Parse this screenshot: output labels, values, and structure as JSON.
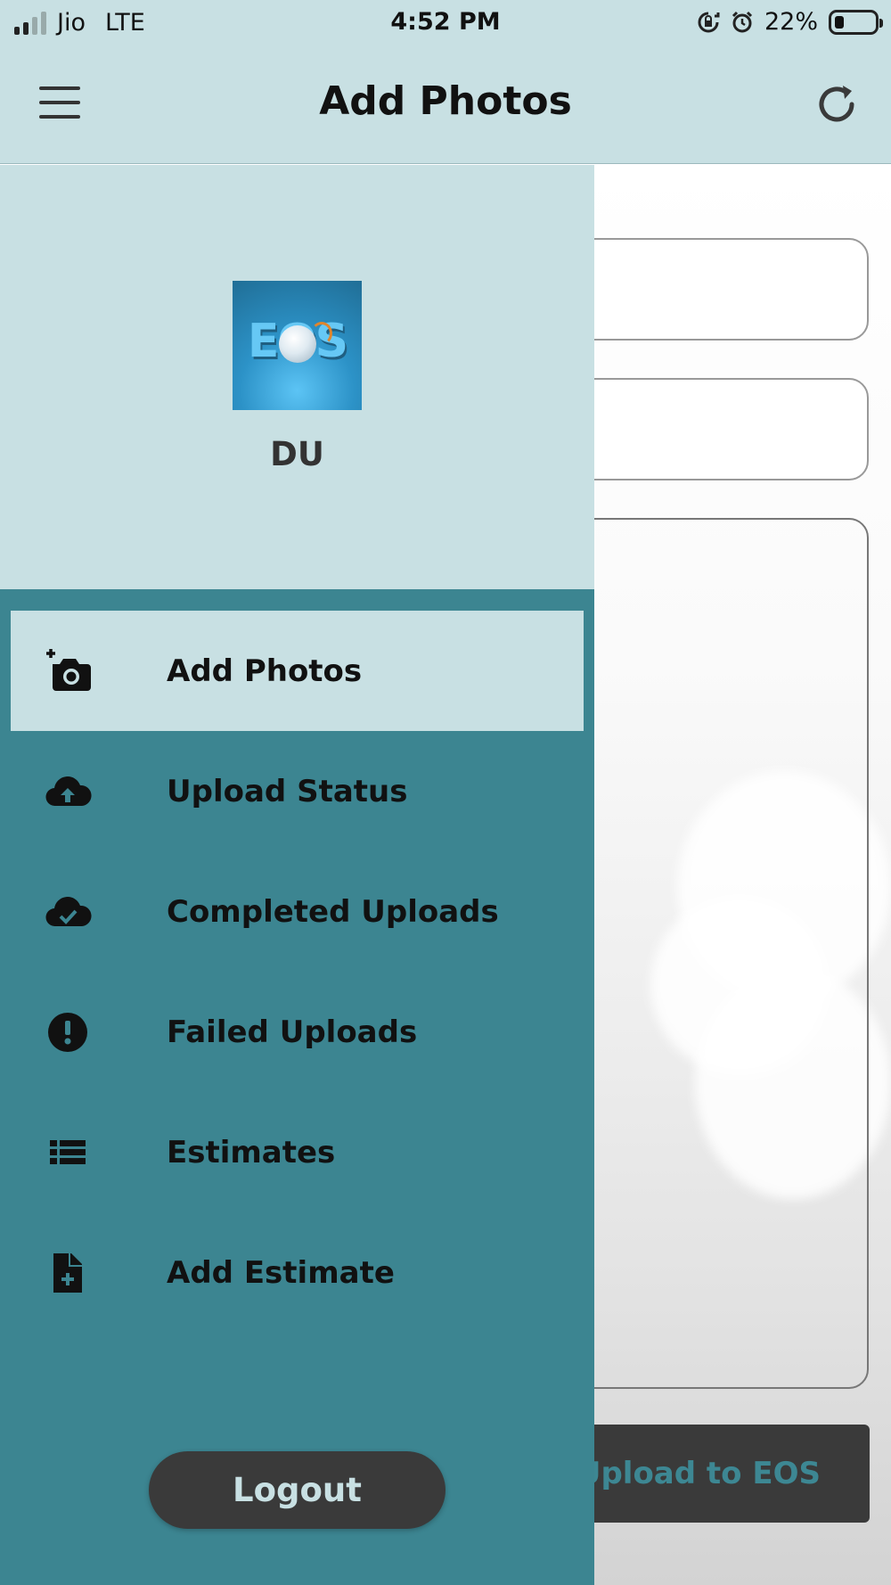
{
  "status_bar": {
    "carrier": "Jio",
    "network": "LTE",
    "time": "4:52 PM",
    "battery": "22%",
    "battery_level": 0.22
  },
  "header": {
    "title": "Add Photos",
    "menu_icon": "hamburger-menu-icon",
    "refresh_icon": "refresh-icon"
  },
  "drawer": {
    "logo_text": "EOS",
    "user_name": "DU",
    "items": [
      {
        "label": "Add Photos",
        "icon": "add-camera-icon",
        "active": true
      },
      {
        "label": "Upload Status",
        "icon": "cloud-upload-icon",
        "active": false
      },
      {
        "label": "Completed Uploads",
        "icon": "cloud-check-icon",
        "active": false
      },
      {
        "label": "Failed Uploads",
        "icon": "alert-circle-icon",
        "active": false
      },
      {
        "label": "Estimates",
        "icon": "list-icon",
        "active": false
      },
      {
        "label": "Add Estimate",
        "icon": "file-plus-icon",
        "active": false
      }
    ],
    "logout_label": "Logout"
  },
  "main": {
    "upload_button_label": "Upload to EOS"
  },
  "colors": {
    "header_bg": "#c8e0e3",
    "drawer_bg": "#3c8591",
    "button_dark": "#3a3a3a",
    "accent_text": "#3d8793"
  }
}
